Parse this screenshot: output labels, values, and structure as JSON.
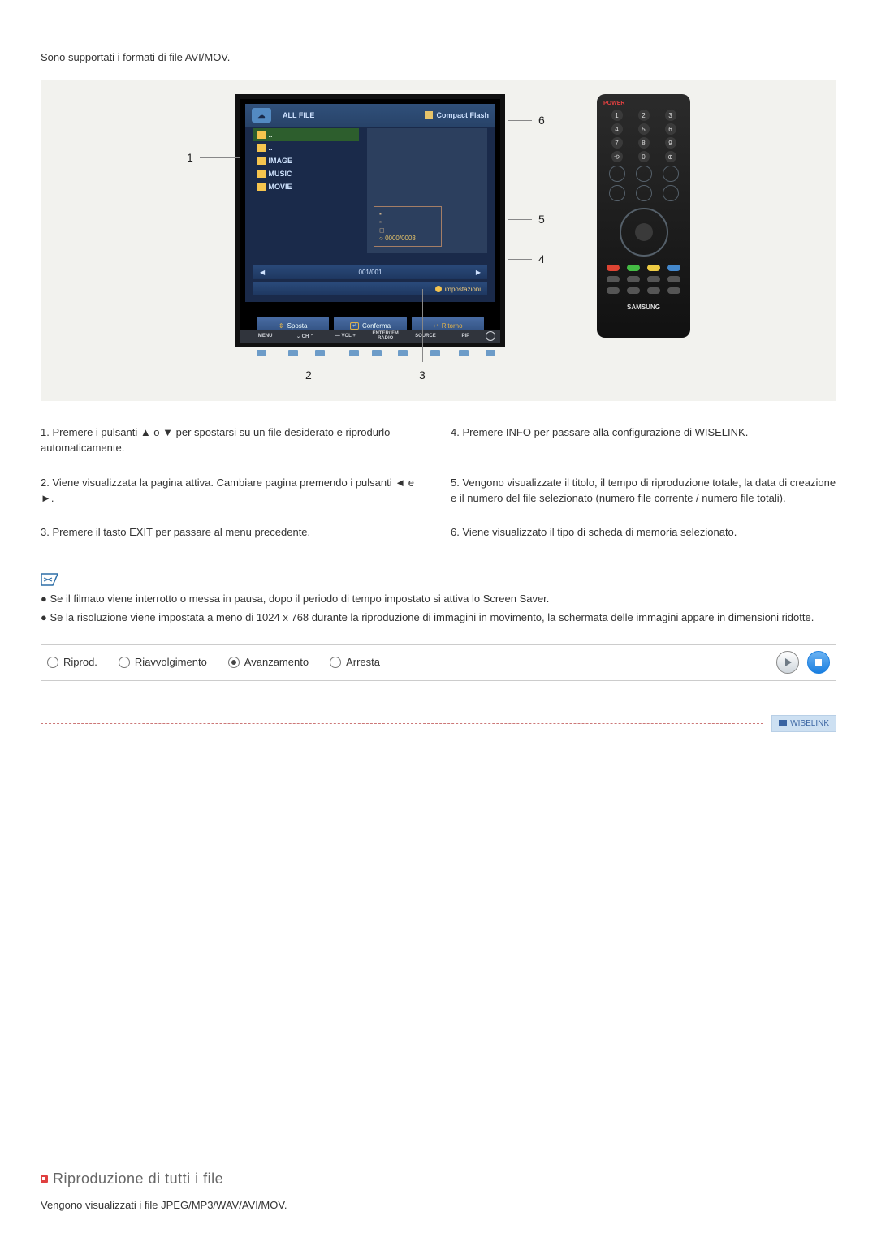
{
  "intro": "Sono supportati i formati di file AVI/MOV.",
  "tv": {
    "all_file": "ALL FILE",
    "compact_flash": "Compact Flash",
    "categories": [
      "..",
      "..",
      "IMAGE",
      "MUSIC",
      "MOVIE"
    ],
    "file_counter": "0000/0003",
    "page_strip": {
      "left": "001/001",
      "right": ""
    },
    "info_label": "impostazioni",
    "bottom_buttons": {
      "sposta": "Sposta",
      "conferma": "Conferma",
      "ritorno": "Ritorno"
    },
    "base_labels": [
      "MENU",
      "CH",
      "VOL",
      "ENTER/\nFM RADIO",
      "SOURCE",
      "PIP"
    ]
  },
  "remote": {
    "power": "POWER",
    "brand": "SAMSUNG"
  },
  "callouts": {
    "n1": "1",
    "n2": "2",
    "n3": "3",
    "n4": "4",
    "n5": "5",
    "n6": "6"
  },
  "descriptions": {
    "d1": "1. Premere i pulsanti ▲ o ▼ per spostarsi su un file desiderato e riprodurlo automaticamente.",
    "d2": "2. Viene visualizzata la pagina attiva. Cambiare pagina premendo i pulsanti ◄ e ►.",
    "d3": "3. Premere il tasto EXIT per passare al menu precedente.",
    "d4": "4. Premere INFO per passare alla configurazione di WISELINK.",
    "d5": "5. Vengono visualizzate il titolo, il tempo di riproduzione totale, la data di creazione e il numero del file selezionato (numero file corrente / numero file totali).",
    "d6": "6. Viene visualizzato il tipo di scheda di memoria selezionato."
  },
  "notes": {
    "n1": "Se il filmato viene interrotto o messa in pausa, dopo il periodo di tempo impostato si attiva lo Screen Saver.",
    "n2": "Se la risoluzione viene impostata a meno di 1024 x 768 durante la riproduzione di immagini in movimento, la schermata delle immagini appare in dimensioni ridotte."
  },
  "radios": {
    "riprod": "Riprod.",
    "riavv": "Riavvolgimento",
    "avanz": "Avanzamento",
    "arresta": "Arresta",
    "selected": "avanz"
  },
  "wiselink": "WISELINK",
  "section2": {
    "title": "Riproduzione di tutti i file",
    "body": "Vengono visualizzati i file JPEG/MP3/WAV/AVI/MOV."
  }
}
